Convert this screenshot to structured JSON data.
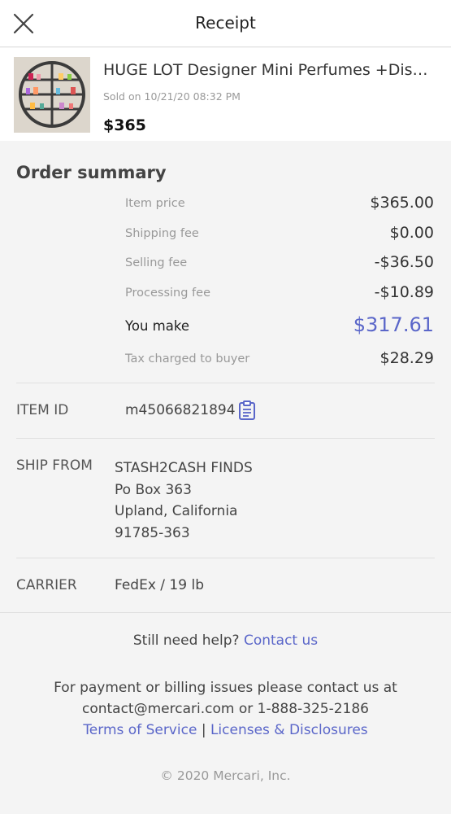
{
  "header": {
    "title": "Receipt"
  },
  "item": {
    "title": "HUGE LOT Designer Mini Perfumes +Display Shelf",
    "sold_on": "Sold on 10/21/20 08:32 PM",
    "price": "$365"
  },
  "order_summary": {
    "title": "Order summary",
    "rows": [
      {
        "label": "Item price",
        "value": "$365.00"
      },
      {
        "label": "Shipping fee",
        "value": "$0.00"
      },
      {
        "label": "Selling fee",
        "value": "-$36.50"
      },
      {
        "label": "Processing fee",
        "value": "-$10.89"
      },
      {
        "label": "You make",
        "value": "$317.61"
      },
      {
        "label": "Tax charged to buyer",
        "value": "$28.29"
      }
    ]
  },
  "item_id": {
    "label": "ITEM ID",
    "value": "m45066821894"
  },
  "ship_from": {
    "label": "SHIP FROM",
    "name": "STASH2CASH FINDS",
    "line1": "Po Box 363",
    "line2": "Upland, California",
    "line3": "91785-363"
  },
  "carrier": {
    "label": "CARRIER",
    "value": "FedEx / 19 lb"
  },
  "help": {
    "text": "Still need help?",
    "link": "Contact us"
  },
  "billing": {
    "line1": "For payment or billing issues please contact us at",
    "line2": "contact@mercari.com or 1-888-325-2186",
    "terms_link": "Terms of Service",
    "separator": "|",
    "licenses_link": "Licenses & Disclosures"
  },
  "footer": {
    "copyright": "© 2020 Mercari, Inc."
  },
  "colors": {
    "accent": "#5a66c9"
  }
}
